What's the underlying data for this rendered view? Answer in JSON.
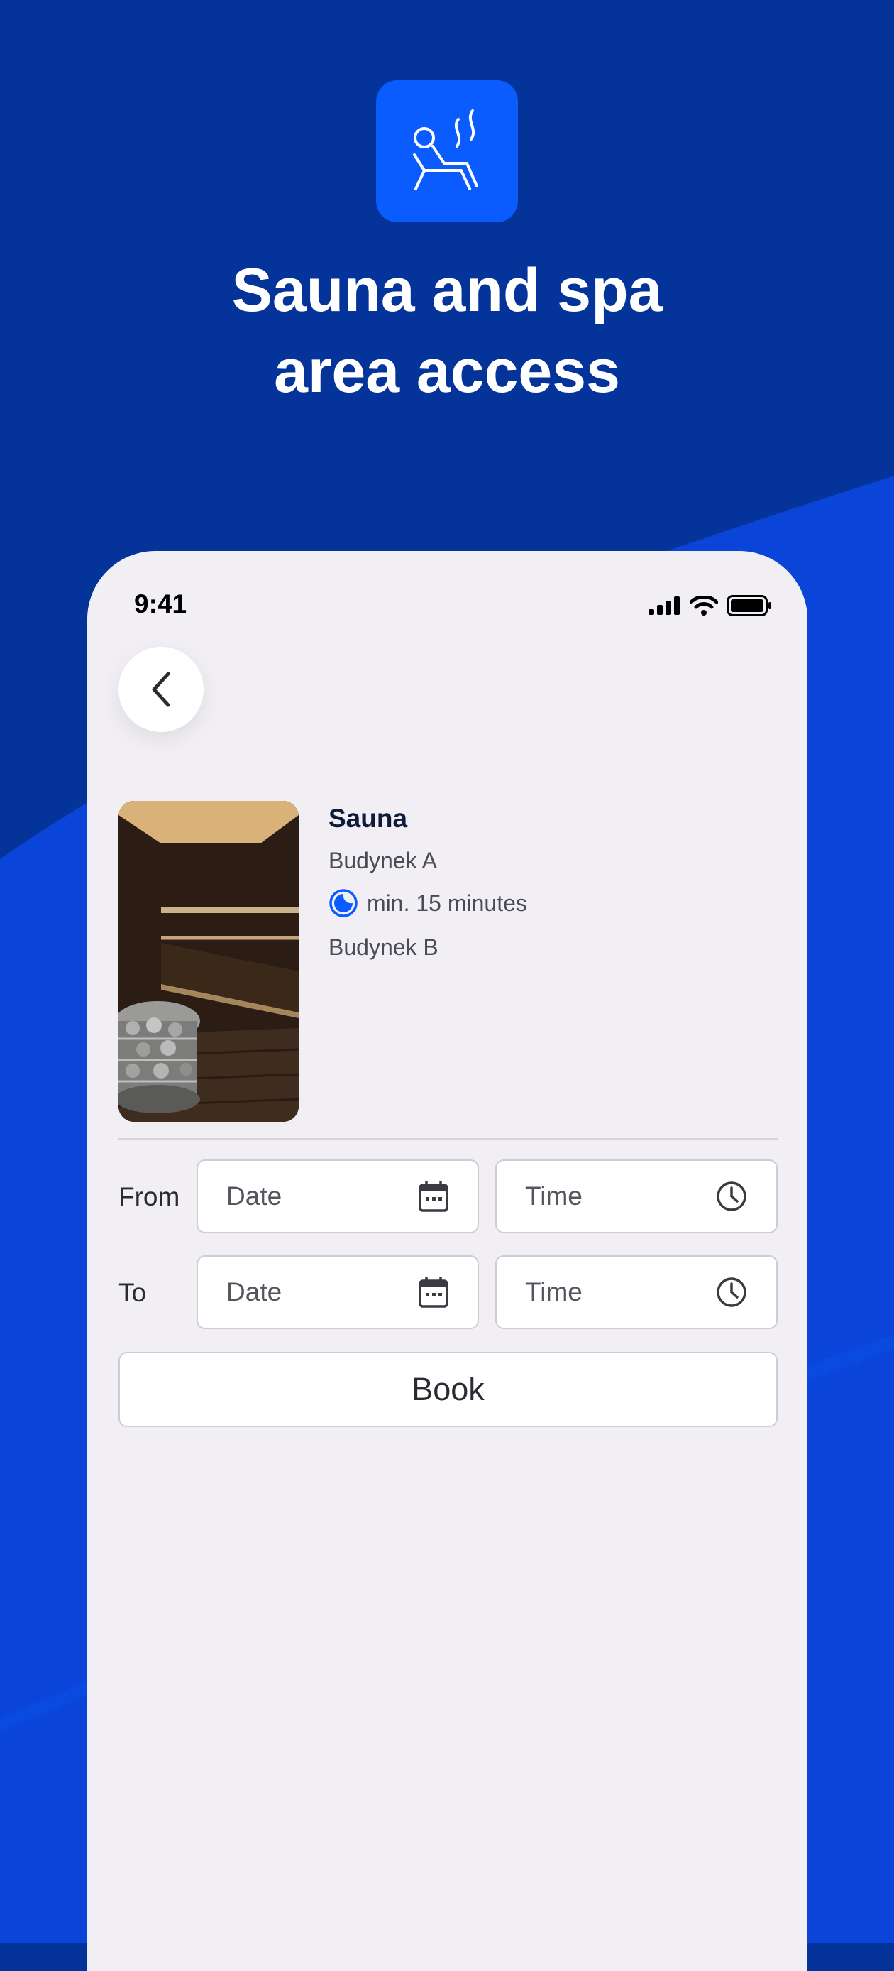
{
  "hero": {
    "icon": "lounger-steam-icon",
    "title_line1": "Sauna and spa",
    "title_line2": "area access"
  },
  "status_bar": {
    "time": "9:41"
  },
  "nav": {
    "back_icon": "chevron-left-icon"
  },
  "facility": {
    "name": "Sauna",
    "location_1": "Budynek A",
    "duration": "min. 15 minutes",
    "location_2": "Budynek B",
    "photo": "sauna-interior-photo"
  },
  "booking": {
    "from_label": "From",
    "to_label": "To",
    "date_placeholder": "Date",
    "time_placeholder": "Time",
    "book_label": "Book"
  },
  "colors": {
    "background": "#04349a",
    "accent": "#0a5cff",
    "card": "#f1eff4"
  }
}
